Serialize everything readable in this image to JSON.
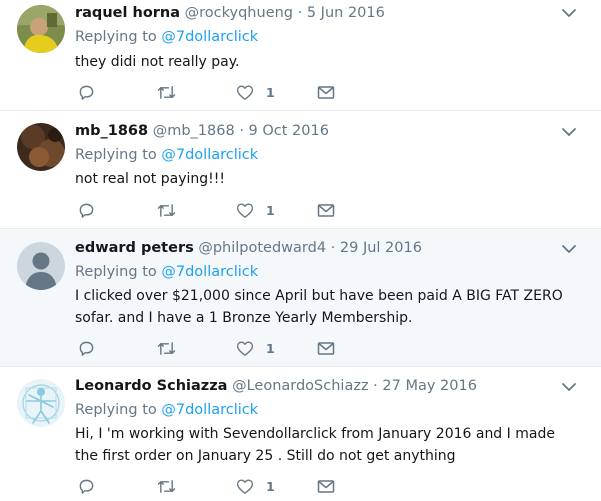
{
  "colors": {
    "accent": "#1da1f2",
    "secondary_text": "#657786",
    "highlight_bg": "#f5f8fa",
    "divider": "#e6ecf0"
  },
  "tweets": [
    {
      "fullname": "raquel horna",
      "screen_name": "@rockyqhueng",
      "separator": "·",
      "date": "5 Jun 2016",
      "replying_prefix": "Replying to",
      "replying_to": "@7dollarclick",
      "text": "they didi not really pay.",
      "like_count": "1",
      "avatar_icon": "photo-avatar-yellow"
    },
    {
      "fullname": "mb_1868",
      "screen_name": "@mb_1868",
      "separator": "·",
      "date": "9 Oct 2016",
      "replying_prefix": "Replying to",
      "replying_to": "@7dollarclick",
      "text": "not real not paying!!!",
      "like_count": "1",
      "avatar_icon": "photo-avatar-dark"
    },
    {
      "fullname": "edward peters",
      "screen_name": "@philpotedward4",
      "separator": "·",
      "date": "29 Jul 2016",
      "replying_prefix": "Replying to",
      "replying_to": "@7dollarclick",
      "text": "I clicked over $21,000 since April but have been paid A BIG FAT ZERO sofar. and  I have a 1  Bronze Yearly Membership.",
      "like_count": "1",
      "avatar_icon": "default-person-avatar"
    },
    {
      "fullname": "Leonardo Schiazza",
      "screen_name": "@LeonardoSchiazz",
      "separator": "·",
      "date": "27 May 2016",
      "replying_prefix": "Replying to",
      "replying_to": "@7dollarclick",
      "text": "Hi, I 'm working with Sevendollarclick from January 2016 and I made the first order on January 25 . Still do not get anything",
      "like_count": "1",
      "avatar_icon": "vitruvian-man-avatar"
    }
  ]
}
